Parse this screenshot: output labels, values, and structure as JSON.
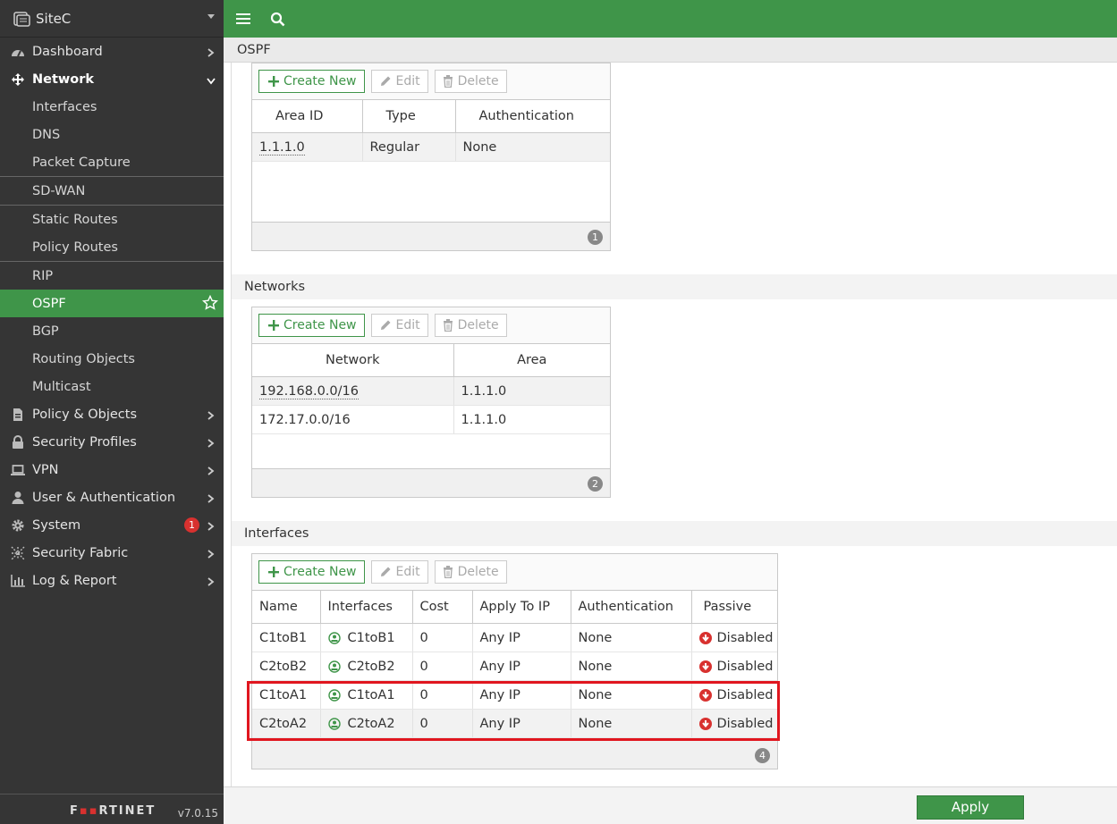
{
  "brand": {
    "name": "SiteC"
  },
  "sidebar": {
    "top_items": [
      {
        "label": "Dashboard"
      },
      {
        "label": "Network"
      },
      {
        "label": "Policy & Objects"
      },
      {
        "label": "Security Profiles"
      },
      {
        "label": "VPN"
      },
      {
        "label": "User & Authentication"
      },
      {
        "label": "System",
        "badge": "1"
      },
      {
        "label": "Security Fabric"
      },
      {
        "label": "Log & Report"
      }
    ],
    "network_sub": [
      "Interfaces",
      "DNS",
      "Packet Capture",
      "SD-WAN",
      "Static Routes",
      "Policy Routes",
      "RIP",
      "OSPF",
      "BGP",
      "Routing Objects",
      "Multicast"
    ],
    "footer": {
      "logo": "FRTINET",
      "version": "v7.0.15"
    }
  },
  "page": {
    "title": "OSPF"
  },
  "toolbar": {
    "create": "Create New",
    "edit": "Edit",
    "delete": "Delete"
  },
  "areas": {
    "headers": [
      "Area ID",
      "Type",
      "Authentication"
    ],
    "rows": [
      [
        "1.1.1.0",
        "Regular",
        "None"
      ]
    ],
    "count": "1"
  },
  "networks": {
    "title": "Networks",
    "headers": [
      "Network",
      "Area"
    ],
    "rows": [
      [
        "192.168.0.0/16",
        "1.1.1.0"
      ],
      [
        "172.17.0.0/16",
        "1.1.1.0"
      ]
    ],
    "count": "2"
  },
  "interfaces": {
    "title": "Interfaces",
    "headers": [
      "Name",
      "Interfaces",
      "Cost",
      "Apply To IP",
      "Authentication",
      "Passive"
    ],
    "rows": [
      [
        "C1toB1",
        "C1toB1",
        "0",
        "Any IP",
        "None",
        "Disabled"
      ],
      [
        "C2toB2",
        "C2toB2",
        "0",
        "Any IP",
        "None",
        "Disabled"
      ],
      [
        "C1toA1",
        "C1toA1",
        "0",
        "Any IP",
        "None",
        "Disabled"
      ],
      [
        "C2toA2",
        "C2toA2",
        "0",
        "Any IP",
        "None",
        "Disabled"
      ]
    ],
    "count": "4"
  },
  "footer": {
    "apply": "Apply"
  },
  "colors": {
    "accent": "#3f9549",
    "sidebar": "#353535",
    "alert": "#d8312f",
    "highlight": "#e0161f"
  }
}
